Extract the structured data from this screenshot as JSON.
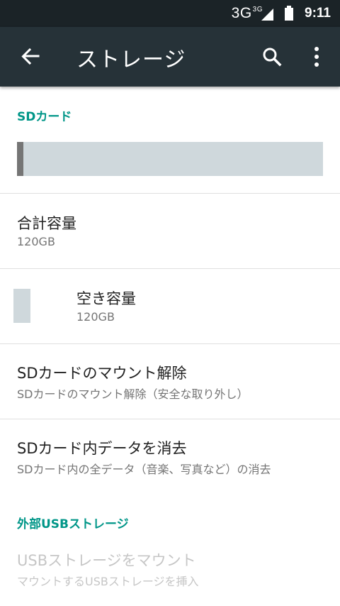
{
  "status_bar": {
    "network": "3G",
    "network_sup": "3G",
    "time": "9:11",
    "icons": [
      "signal-icon",
      "battery-icon"
    ]
  },
  "app_bar": {
    "title": "ストレージ",
    "icons": [
      "back-arrow-icon",
      "search-icon",
      "more-vert-icon"
    ]
  },
  "sd_card": {
    "header": "SDカード",
    "usage_fraction_used": 0.02,
    "total": {
      "title": "合計容量",
      "value": "120GB"
    },
    "free": {
      "title": "空き容量",
      "value": "120GB"
    },
    "unmount": {
      "title": "SDカードのマウント解除",
      "subtitle": "SDカードのマウント解除（安全な取り外し）"
    },
    "erase": {
      "title": "SDカード内データを消去",
      "subtitle": "SDカード内の全データ（音楽、写真など）の消去"
    }
  },
  "usb_storage": {
    "header": "外部USBストレージ",
    "mount": {
      "title": "USBストレージをマウント",
      "subtitle": "マウントするUSBストレージを挿入"
    }
  },
  "colors": {
    "app_bar": "#263238",
    "status_bar": "#1b2327",
    "accent": "#009688",
    "bar_free": "#cfd8dc",
    "bar_used": "#757575"
  }
}
